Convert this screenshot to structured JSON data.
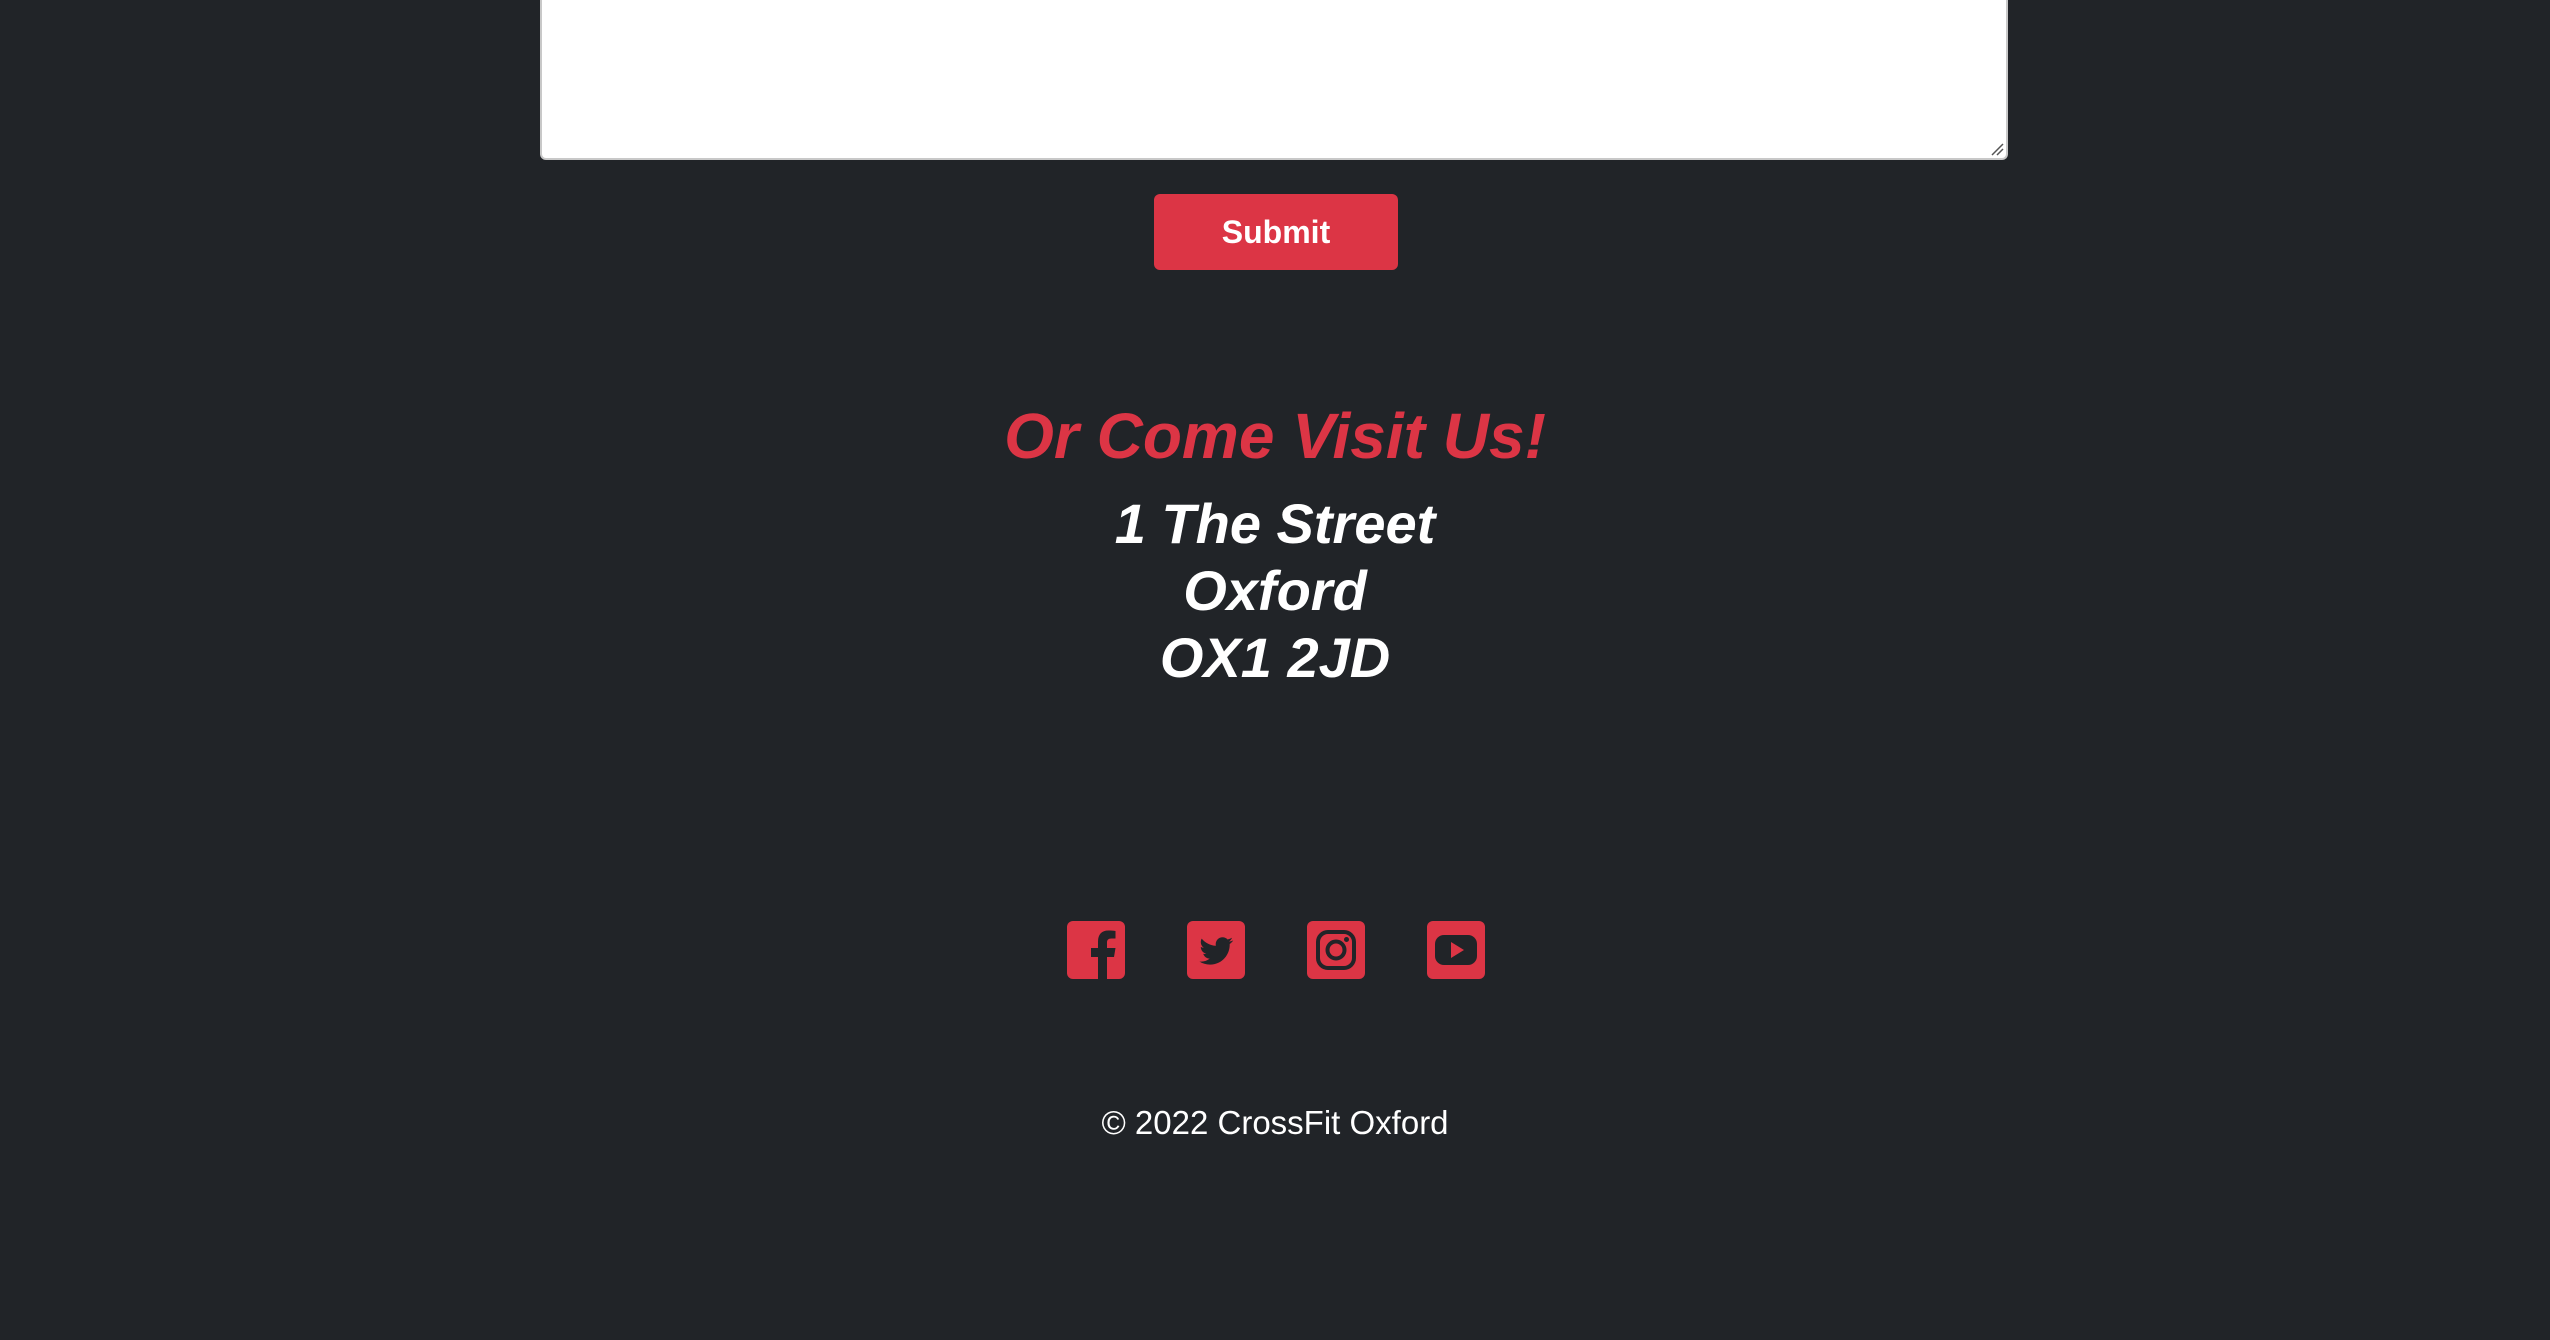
{
  "contact_form": {
    "message_value": "",
    "submit_label": "Submit"
  },
  "visit": {
    "heading": "Or Come Visit Us!",
    "address": {
      "street": "1 The Street",
      "city": "Oxford",
      "postcode": "OX1 2JD"
    }
  },
  "socials": [
    {
      "name": "facebook",
      "icon": "facebook-icon"
    },
    {
      "name": "twitter",
      "icon": "twitter-icon"
    },
    {
      "name": "instagram",
      "icon": "instagram-icon"
    },
    {
      "name": "youtube",
      "icon": "youtube-icon"
    }
  ],
  "footer": {
    "copyright": "© 2022 CrossFit Oxford"
  },
  "colors": {
    "background": "#212428",
    "accent": "#dc3545",
    "text": "#ffffff"
  }
}
